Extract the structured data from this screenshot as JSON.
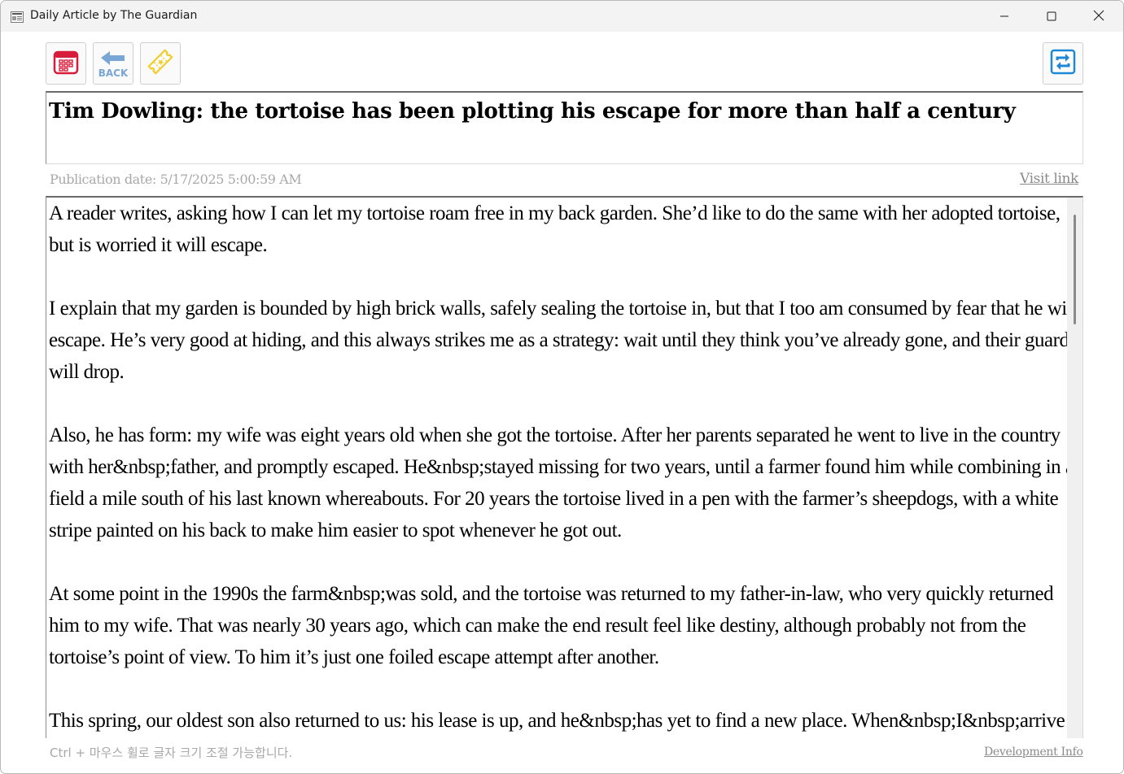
{
  "window": {
    "title": "Daily Article by The Guardian",
    "app_icon": "newspaper-icon",
    "controls": [
      "minimize-icon",
      "maximize-icon",
      "close-icon"
    ]
  },
  "toolbar": {
    "calendar_icon": "calendar-icon",
    "back_label": "BACK",
    "back_icon": "back-arrow-icon",
    "ticket_icon": "ticket-icon",
    "refresh_icon": "refresh-icon",
    "colors": {
      "calendar": "#d71b3b",
      "back": "#7aa6d6",
      "ticket": "#f2cc2f",
      "refresh": "#1e88d4"
    }
  },
  "article": {
    "headline": "Tim Dowling: the tortoise has been plotting his escape for more than half a century",
    "publication_date": "Publication date: 5/17/2025 5:00:59 AM",
    "visit_link": "Visit link",
    "lines": [
      "A reader writes, asking how I can let my tortoise roam free in my back garden. She’d like to do the same with her adopted tortoise,",
      "but is worried it will escape.",
      "",
      "I explain that my garden is bounded by high brick walls, safely sealing the tortoise in, but that I too am consumed by fear that he will",
      "escape. He’s very good at hiding, and this always strikes me as a strategy: wait until they think you’ve already gone, and their guard",
      "will drop.",
      "",
      "Also, he has form: my wife was eight years old when she got the tortoise. After her parents separated he went to live in the country",
      "with her&nbsp;father, and promptly escaped. He&nbsp;stayed missing for two years, until a farmer found him while combining in a",
      "field a mile south of his last known whereabouts. For 20 years the tortoise lived in a pen with the farmer’s sheepdogs, with a white",
      "stripe painted on his back to make him easier to spot whenever he got out.",
      "",
      "At some point in the 1990s the farm&nbsp;was sold, and the tortoise was returned to my father-in-law, who very quickly returned",
      "him to my wife. That was nearly 30 years ago, which can make the end result feel like destiny, although probably not from the",
      "tortoise’s point of view. To him it’s just one foiled escape attempt after another.",
      "",
      "This spring, our oldest son also returned to us: his lease is up, and he&nbsp;has yet to find a new place. When&nbsp;I&nbsp;arrive"
    ]
  },
  "footer": {
    "hint": "Ctrl + 마우스 휠로 글자 크기 조절 가능합니다.",
    "dev_info": "Development Info"
  }
}
